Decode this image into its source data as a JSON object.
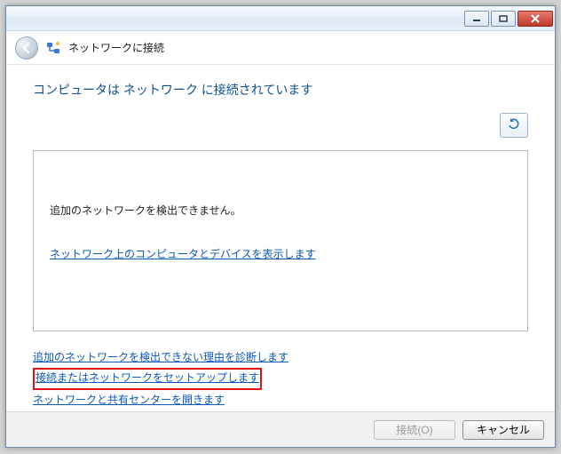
{
  "window": {
    "title": "ネットワークに接続"
  },
  "content": {
    "heading": "コンピュータは ネットワーク に接続されています",
    "panel_message": "追加のネットワークを検出できません。",
    "panel_link": "ネットワーク上のコンピュータとデバイスを表示します",
    "links": {
      "diag": "追加のネットワークを検出できない理由を診断します",
      "setup": "接続またはネットワークをセットアップします",
      "center": "ネットワークと共有センターを開きます"
    }
  },
  "buttons": {
    "connect": "接続(O)",
    "cancel": "キャンセル"
  }
}
